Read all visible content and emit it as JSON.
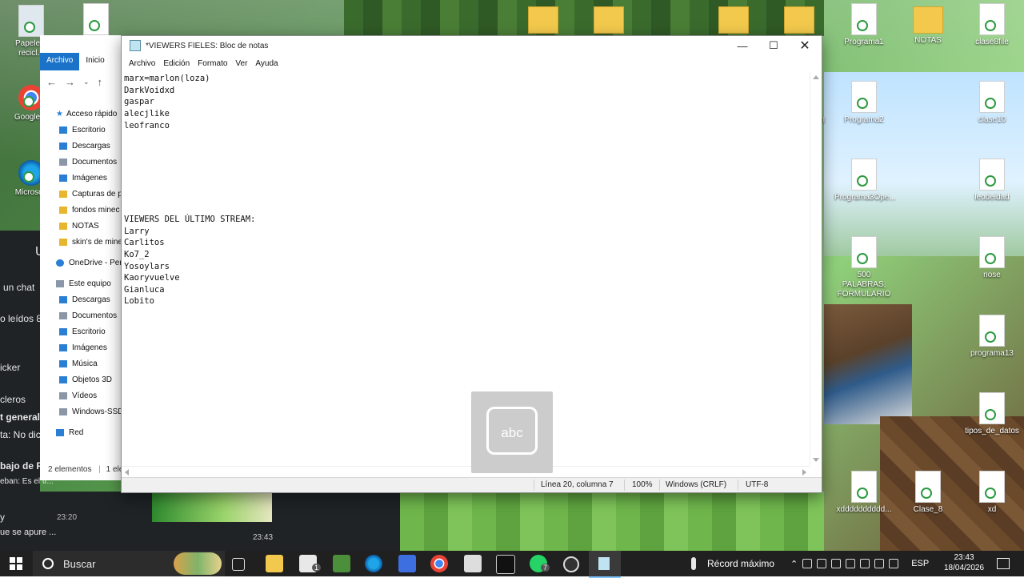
{
  "notepad": {
    "title": "*VIEWERS FIELES: Bloc de notas",
    "menu": [
      "Archivo",
      "Edición",
      "Formato",
      "Ver",
      "Ayuda"
    ],
    "lines": [
      "marx=marlon(loza)",
      "DarkVoidxd",
      "gaspar",
      "alecjlike",
      "leofranco",
      "",
      "",
      "",
      "",
      "",
      "",
      "",
      "VIEWERS DEL ÚLTIMO STREAM:",
      "Larry",
      "Carlitos",
      "Ko7_2",
      "Yosoylars",
      "Kaoryvuelve",
      "Gianluca",
      "Lobito"
    ],
    "status": {
      "position": "Línea 20, columna 7",
      "zoom": "100%",
      "eol": "Windows (CRLF)",
      "encoding": "UTF-8"
    }
  },
  "keyboard_overlay": {
    "label": "abc"
  },
  "explorer": {
    "tabs": [
      "Archivo",
      "Inicio"
    ],
    "quick_access": "Acceso rápido",
    "items": [
      "Escritorio",
      "Descargas",
      "Documentos",
      "Imágenes",
      "Capturas de p",
      "fondos minec",
      "NOTAS",
      "skin's de mine"
    ],
    "onedrive": "OneDrive - Pers",
    "this_pc": "Este equipo",
    "pc_items": [
      "Descargas",
      "Documentos",
      "Escritorio",
      "Imágenes",
      "Música",
      "Objetos 3D",
      "Vídeos",
      "Windows-SSD"
    ],
    "network": "Red",
    "status": "2 elementos",
    "status2": "1 ele"
  },
  "desktop_left": [
    "Papelera recicl...",
    "Google C",
    "Microsoft"
  ],
  "desktop_right": [
    "Programa1",
    "NOTAS",
    "clase8file",
    "Programa2",
    "clase10",
    "Programa3Ope...",
    "leodeidad",
    "500 PALABRAS, FORMULARIO",
    "nose",
    "programa13",
    "tipos_de_datos",
    "xdddddddddd...",
    "Clase_8",
    "xd"
  ],
  "desktop_partial": [
    "to",
    "s II"
  ],
  "chat": {
    "lines": [
      "un chat",
      "o leídos 8",
      "icker",
      "cleros",
      "t general",
      "ta: No dic",
      "bajo de R",
      "eban: Es el tr...",
      "y",
      "ue se apure ..."
    ],
    "time1": "23:20",
    "time2": "23:43"
  },
  "taskbar": {
    "search": "Buscar",
    "record_label": "Récord máximo",
    "lang": "ESP",
    "time": "23:43",
    "date": "18/04/2026",
    "badge1": "1",
    "badge2": "7"
  }
}
